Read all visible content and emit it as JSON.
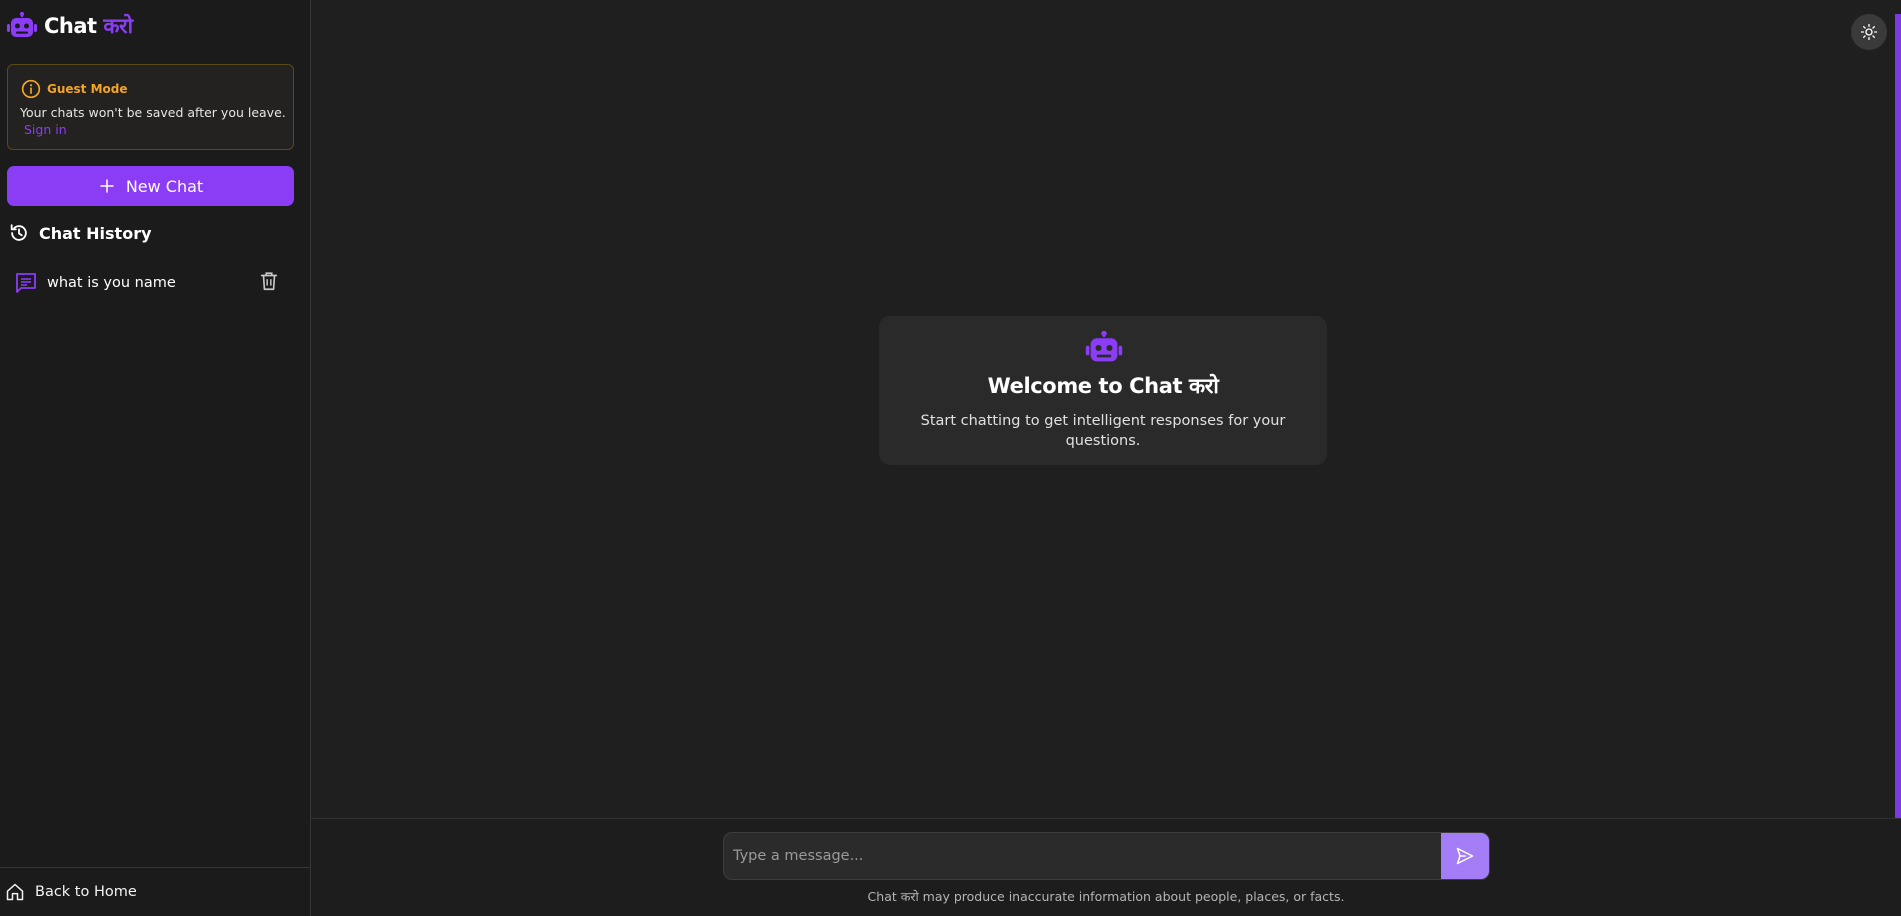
{
  "app": {
    "logo_text_main": "Chat",
    "logo_text_accent": "करो",
    "accent_color": "#8b3cf5"
  },
  "sidebar": {
    "guest": {
      "title": "Guest Mode",
      "message": "Your chats won't be saved after you leave.",
      "signin_label": "Sign in",
      "icon": "info-icon",
      "color": "#f5a524"
    },
    "new_chat_label": "New Chat",
    "history_title": "Chat History",
    "history_items": [
      {
        "label": "what is you name",
        "icon": "chat-icon",
        "action_icon": "trash-icon"
      }
    ],
    "back_home_label": "Back to Home"
  },
  "main": {
    "theme_toggle_icon": "sun-icon",
    "welcome": {
      "title": "Welcome to Chat करो",
      "subtitle": "Start chatting to get intelligent responses for your questions.",
      "icon": "robot-icon"
    },
    "input": {
      "placeholder": "Type a message...",
      "value": "",
      "send_icon": "send-icon"
    },
    "disclaimer": "Chat करो may produce inaccurate information about people, places, or facts."
  }
}
